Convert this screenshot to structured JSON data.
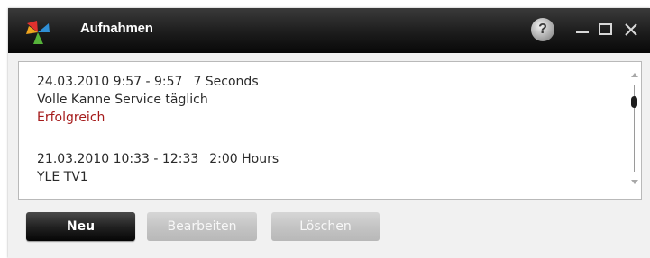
{
  "window": {
    "title": "Aufnahmen"
  },
  "titlebar": {
    "help_label": "?",
    "icons": [
      "app-logo-icon",
      "help-icon",
      "minimize-icon",
      "maximize-icon",
      "close-icon"
    ]
  },
  "recordings": [
    {
      "time": "24.03.2010 9:57 - 9:57",
      "duration": "7 Seconds",
      "channel": "Volle Kanne Service täglich",
      "status": "Erfolgreich"
    },
    {
      "time": "21.03.2010 10:33 - 12:33",
      "duration": "2:00 Hours",
      "channel": "YLE TV1"
    }
  ],
  "buttons": {
    "new": "Neu",
    "edit": "Bearbeiten",
    "delete": "Löschen"
  },
  "colors": {
    "titlebar": "#1c1c1c",
    "status_success": "#a51b1b",
    "button_primary": "#222222",
    "button_disabled": "#c4c4c4"
  }
}
